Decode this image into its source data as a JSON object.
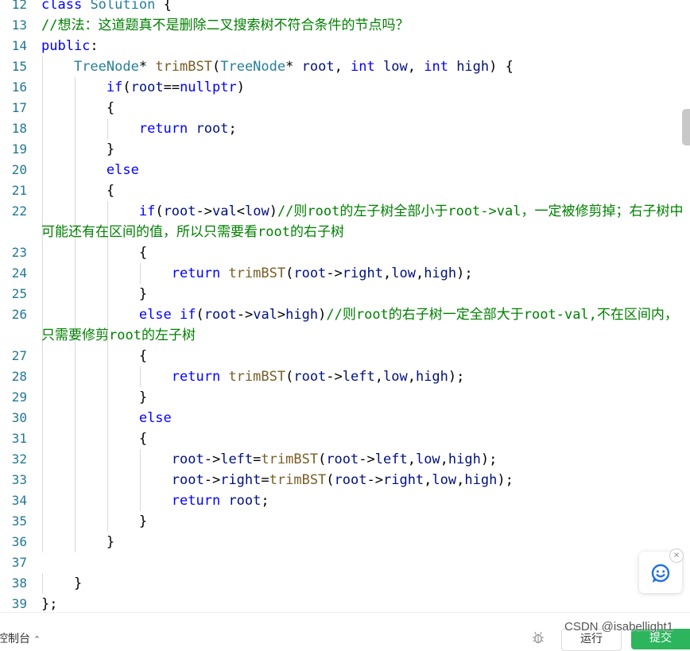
{
  "editor": {
    "lines": [
      {
        "n": "12",
        "tokens": [
          [
            "kw",
            "class"
          ],
          [
            "pl",
            " "
          ],
          [
            "ty",
            "Solution"
          ],
          [
            "pl",
            " {"
          ]
        ]
      },
      {
        "n": "13",
        "tokens": [
          [
            "cm",
            "//想法：这道题真不是删除二叉搜索树不符合条件的节点吗？"
          ]
        ]
      },
      {
        "n": "14",
        "tokens": [
          [
            "kw",
            "public"
          ],
          [
            "pl",
            ":"
          ]
        ]
      },
      {
        "n": "15",
        "tokens": [
          [
            "pl",
            "    "
          ],
          [
            "ty",
            "TreeNode"
          ],
          [
            "pl",
            "* "
          ],
          [
            "fn",
            "trimBST"
          ],
          [
            "pl",
            "("
          ],
          [
            "ty",
            "TreeNode"
          ],
          [
            "pl",
            "* "
          ],
          [
            "id",
            "root"
          ],
          [
            "pl",
            ", "
          ],
          [
            "kw",
            "int"
          ],
          [
            "pl",
            " "
          ],
          [
            "id",
            "low"
          ],
          [
            "pl",
            ", "
          ],
          [
            "kw",
            "int"
          ],
          [
            "pl",
            " "
          ],
          [
            "id",
            "high"
          ],
          [
            "pl",
            ") {"
          ]
        ]
      },
      {
        "n": "16",
        "tokens": [
          [
            "pl",
            "        "
          ],
          [
            "kw",
            "if"
          ],
          [
            "pl",
            "("
          ],
          [
            "id",
            "root"
          ],
          [
            "pl",
            "=="
          ],
          [
            "kw",
            "nullptr"
          ],
          [
            "pl",
            ")"
          ]
        ]
      },
      {
        "n": "17",
        "tokens": [
          [
            "pl",
            "        {"
          ]
        ]
      },
      {
        "n": "18",
        "tokens": [
          [
            "pl",
            "            "
          ],
          [
            "kw",
            "return"
          ],
          [
            "pl",
            " "
          ],
          [
            "id",
            "root"
          ],
          [
            "pl",
            ";"
          ]
        ]
      },
      {
        "n": "19",
        "tokens": [
          [
            "pl",
            "        }"
          ]
        ]
      },
      {
        "n": "20",
        "tokens": [
          [
            "pl",
            "        "
          ],
          [
            "kw",
            "else"
          ]
        ]
      },
      {
        "n": "21",
        "tokens": [
          [
            "pl",
            "        {"
          ]
        ]
      },
      {
        "n": "22",
        "wrap": true,
        "tokens": [
          [
            "pl",
            "            "
          ],
          [
            "kw",
            "if"
          ],
          [
            "pl",
            "("
          ],
          [
            "id",
            "root"
          ],
          [
            "pl",
            "->"
          ],
          [
            "id",
            "val"
          ],
          [
            "pl",
            "<"
          ],
          [
            "id",
            "low"
          ],
          [
            "pl",
            ")"
          ],
          [
            "cm",
            "//则root的左子树全部小于root->val，一定被修剪掉；右子树中可能还有在区间的值，所以只需要看root的右子树"
          ]
        ]
      },
      {
        "n": "23",
        "tokens": [
          [
            "pl",
            "            {"
          ]
        ]
      },
      {
        "n": "24",
        "tokens": [
          [
            "pl",
            "                "
          ],
          [
            "kw",
            "return"
          ],
          [
            "pl",
            " "
          ],
          [
            "fn",
            "trimBST"
          ],
          [
            "pl",
            "("
          ],
          [
            "id",
            "root"
          ],
          [
            "pl",
            "->"
          ],
          [
            "id",
            "right"
          ],
          [
            "pl",
            ","
          ],
          [
            "id",
            "low"
          ],
          [
            "pl",
            ","
          ],
          [
            "id",
            "high"
          ],
          [
            "pl",
            ");"
          ]
        ]
      },
      {
        "n": "25",
        "tokens": [
          [
            "pl",
            "            }"
          ]
        ]
      },
      {
        "n": "26",
        "wrap": true,
        "tokens": [
          [
            "pl",
            "            "
          ],
          [
            "kw",
            "else"
          ],
          [
            "pl",
            " "
          ],
          [
            "kw",
            "if"
          ],
          [
            "pl",
            "("
          ],
          [
            "id",
            "root"
          ],
          [
            "pl",
            "->"
          ],
          [
            "id",
            "val"
          ],
          [
            "pl",
            ">"
          ],
          [
            "id",
            "high"
          ],
          [
            "pl",
            ")"
          ],
          [
            "cm",
            "//则root的右子树一定全部大于root-val,不在区间内，只需要修剪root的左子树"
          ]
        ]
      },
      {
        "n": "27",
        "tokens": [
          [
            "pl",
            "            {"
          ]
        ]
      },
      {
        "n": "28",
        "tokens": [
          [
            "pl",
            "                "
          ],
          [
            "kw",
            "return"
          ],
          [
            "pl",
            " "
          ],
          [
            "fn",
            "trimBST"
          ],
          [
            "pl",
            "("
          ],
          [
            "id",
            "root"
          ],
          [
            "pl",
            "->"
          ],
          [
            "id",
            "left"
          ],
          [
            "pl",
            ","
          ],
          [
            "id",
            "low"
          ],
          [
            "pl",
            ","
          ],
          [
            "id",
            "high"
          ],
          [
            "pl",
            ");"
          ]
        ]
      },
      {
        "n": "29",
        "tokens": [
          [
            "pl",
            "            }"
          ]
        ]
      },
      {
        "n": "30",
        "tokens": [
          [
            "pl",
            "            "
          ],
          [
            "kw",
            "else"
          ]
        ]
      },
      {
        "n": "31",
        "tokens": [
          [
            "pl",
            "            {"
          ]
        ]
      },
      {
        "n": "32",
        "tokens": [
          [
            "pl",
            "                "
          ],
          [
            "id",
            "root"
          ],
          [
            "pl",
            "->"
          ],
          [
            "id",
            "left"
          ],
          [
            "pl",
            "="
          ],
          [
            "fn",
            "trimBST"
          ],
          [
            "pl",
            "("
          ],
          [
            "id",
            "root"
          ],
          [
            "pl",
            "->"
          ],
          [
            "id",
            "left"
          ],
          [
            "pl",
            ","
          ],
          [
            "id",
            "low"
          ],
          [
            "pl",
            ","
          ],
          [
            "id",
            "high"
          ],
          [
            "pl",
            ");"
          ]
        ]
      },
      {
        "n": "33",
        "tokens": [
          [
            "pl",
            "                "
          ],
          [
            "id",
            "root"
          ],
          [
            "pl",
            "->"
          ],
          [
            "id",
            "right"
          ],
          [
            "pl",
            "="
          ],
          [
            "fn",
            "trimBST"
          ],
          [
            "pl",
            "("
          ],
          [
            "id",
            "root"
          ],
          [
            "pl",
            "->"
          ],
          [
            "id",
            "right"
          ],
          [
            "pl",
            ","
          ],
          [
            "id",
            "low"
          ],
          [
            "pl",
            ","
          ],
          [
            "id",
            "high"
          ],
          [
            "pl",
            ");"
          ]
        ]
      },
      {
        "n": "34",
        "tokens": [
          [
            "pl",
            "                "
          ],
          [
            "kw",
            "return"
          ],
          [
            "pl",
            " "
          ],
          [
            "id",
            "root"
          ],
          [
            "pl",
            ";"
          ]
        ]
      },
      {
        "n": "35",
        "tokens": [
          [
            "pl",
            "            }"
          ]
        ]
      },
      {
        "n": "36",
        "tokens": [
          [
            "pl",
            "        }"
          ]
        ]
      },
      {
        "n": "37",
        "tokens": [
          [
            "pl",
            ""
          ]
        ]
      },
      {
        "n": "38",
        "tokens": [
          [
            "pl",
            "    }"
          ]
        ]
      },
      {
        "n": "39",
        "tokens": [
          [
            "pl",
            "};"
          ]
        ]
      }
    ]
  },
  "colors": {
    "keyword": "#0000ff",
    "type": "#267f99",
    "comment": "#008000",
    "identifier": "#001080",
    "function": "#795e26",
    "line_number": "#237893",
    "submit": "#2db55d"
  },
  "icons": {
    "feedback": "chat-smile-icon",
    "close": "close-icon",
    "console_chevron": "chevron-up-icon",
    "debug": "bug-icon"
  },
  "bottombar": {
    "console_label": "控制台",
    "console_chevron": "⌃",
    "run_label": "运行",
    "submit_label": "提交"
  },
  "feedback": {
    "close_glyph": "×"
  },
  "watermark": "CSDN @isabellight1"
}
